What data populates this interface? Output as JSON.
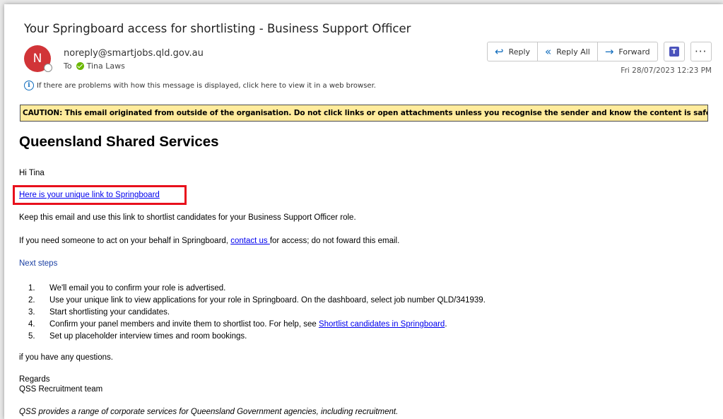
{
  "email": {
    "subject": "Your Springboard access for shortlisting - Business Support Officer",
    "avatar_initial": "N",
    "sender": "noreply@smartjobs.qld.gov.au",
    "to_label": "To",
    "recipient": "Tina Laws",
    "info_notice": "If there are problems with how this message is displayed, click here to view it in a web browser.",
    "date": "Fri 28/07/2023 12:23 PM"
  },
  "actions": {
    "reply": "Reply",
    "reply_all": "Reply All",
    "forward": "Forward",
    "more": "···"
  },
  "caution": "CAUTION: This email originated from outside of the organisation. Do not click links or open attachments unless you recognise the sender and know the content is safe.",
  "body": {
    "org_title": "Queensland Shared Services",
    "greeting": "Hi Tina",
    "unique_link": "Here is your unique link to Springboard",
    "keep_email": "Keep this email and use this link to shortlist candidates for your Business Support Officer role.",
    "behalf_pre": "If you need someone to act on your behalf in Springboard, ",
    "contact_link": "contact us ",
    "behalf_post": "for access; do not foward this email.",
    "next_steps": "Next steps",
    "steps": [
      {
        "num": "1.",
        "text": "We'll email you to confirm your role is advertised."
      },
      {
        "num": "2.",
        "text": "Use your unique link to view applications for your role in Springboard. On the dashboard, select job number QLD/341939."
      },
      {
        "num": "3.",
        "text": "Start shortlisting your candidates."
      },
      {
        "num": "4.",
        "text": "Confirm your panel members and invite them to shortlist too. For help, see ",
        "link": "Shortlist candidates in Springboard",
        "after": "."
      },
      {
        "num": "5.",
        "text": "Set up placeholder interview times and room bookings."
      }
    ],
    "questions": "if you have any questions.",
    "regards": "Regards",
    "team": "QSS Recruitment team",
    "footer": "QSS provides a range of corporate services for Queensland Government agencies, including recruitment."
  },
  "colors": {
    "avatar": "#d13438",
    "caution_bg": "#ffeb9c",
    "highlight_box": "#e8101c",
    "link": "#0000ee",
    "action_icon": "#0f6cbd"
  }
}
